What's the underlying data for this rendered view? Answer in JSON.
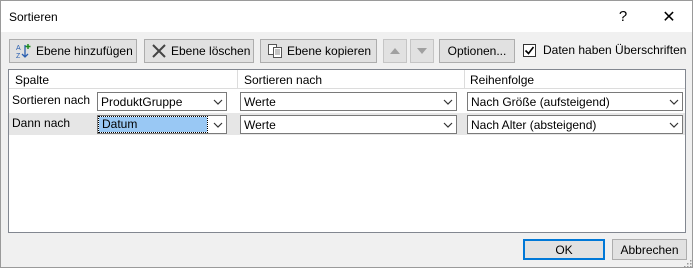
{
  "window": {
    "title": "Sortieren"
  },
  "titlebar": {
    "help": "?",
    "close": "✕"
  },
  "toolbar": {
    "add_level": "Ebene hinzufügen",
    "delete_level": "Ebene löschen",
    "copy_level": "Ebene kopieren",
    "move_up": "▲",
    "move_down": "▼",
    "options": "Optionen...",
    "headers_checkbox": {
      "label": "Daten haben Überschriften",
      "checked": true
    }
  },
  "grid": {
    "headers": {
      "column": "Spalte",
      "sort_on": "Sortieren nach",
      "order": "Reihenfolge"
    },
    "rows": [
      {
        "label": "Sortieren nach",
        "column": "ProduktGruppe",
        "sort_on": "Werte",
        "order": "Nach Größe (aufsteigend)"
      },
      {
        "label": "Dann nach",
        "column": "Datum",
        "sort_on": "Werte",
        "order": "Nach Alter (absteigend)"
      }
    ]
  },
  "footer": {
    "ok": "OK",
    "cancel": "Abbrechen"
  },
  "colors": {
    "accent": "#0078d7",
    "selection": "#99c8f4",
    "row_selected_bg": "#e6e6e6"
  }
}
